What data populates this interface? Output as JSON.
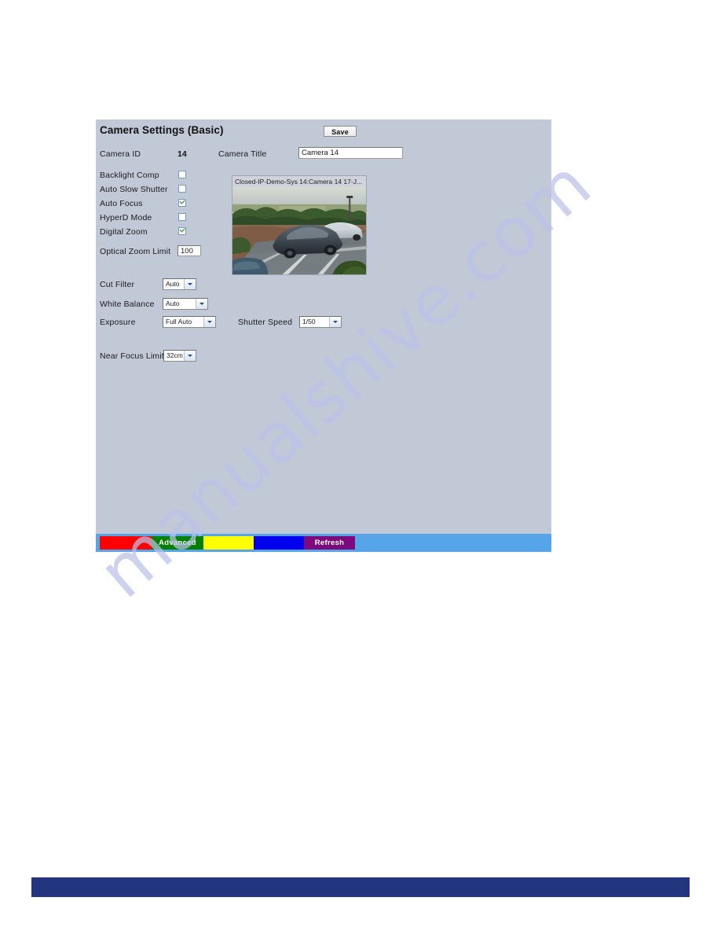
{
  "panel": {
    "title": "Camera Settings (Basic)",
    "save_label": "Save",
    "fields": {
      "camera_id_label": "Camera ID",
      "camera_id_value": "14",
      "camera_title_label": "Camera Title",
      "camera_title_value": "Camera 14",
      "optical_zoom_label": "Optical Zoom Limit",
      "optical_zoom_value": "100"
    },
    "checkboxes": [
      {
        "label": "Backlight Comp",
        "checked": false
      },
      {
        "label": "Auto Slow Shutter",
        "checked": false
      },
      {
        "label": "Auto Focus",
        "checked": true
      },
      {
        "label": "HyperD Mode",
        "checked": false
      },
      {
        "label": "Digital Zoom",
        "checked": true
      }
    ],
    "selects": [
      {
        "label": "Cut Filter",
        "value": "Auto"
      },
      {
        "label": "White Balance",
        "value": "Auto"
      },
      {
        "label": "Exposure",
        "value": "Full Auto"
      },
      {
        "label": "Shutter Speed",
        "value": "1/50"
      },
      {
        "label": "Near Focus Limit",
        "value": "32cm"
      }
    ],
    "preview": {
      "osd_text": "Closed-IP-Demo-Sys 14:Camera 14 17-J..."
    }
  },
  "navbar": {
    "segments": [
      {
        "label": "",
        "color": "#ff0000"
      },
      {
        "label": "Advanced",
        "color": "#008000"
      },
      {
        "label": "",
        "color": "#ffff00"
      },
      {
        "label": "",
        "color": "#0000ef"
      },
      {
        "label": "Refresh",
        "color": "#7c0a7c"
      }
    ],
    "bar_color": "#56a5e8"
  },
  "footer": {
    "bar_color": "#24357f"
  },
  "watermark": {
    "text": "manualshive.com",
    "color": "#bcc2e8"
  }
}
